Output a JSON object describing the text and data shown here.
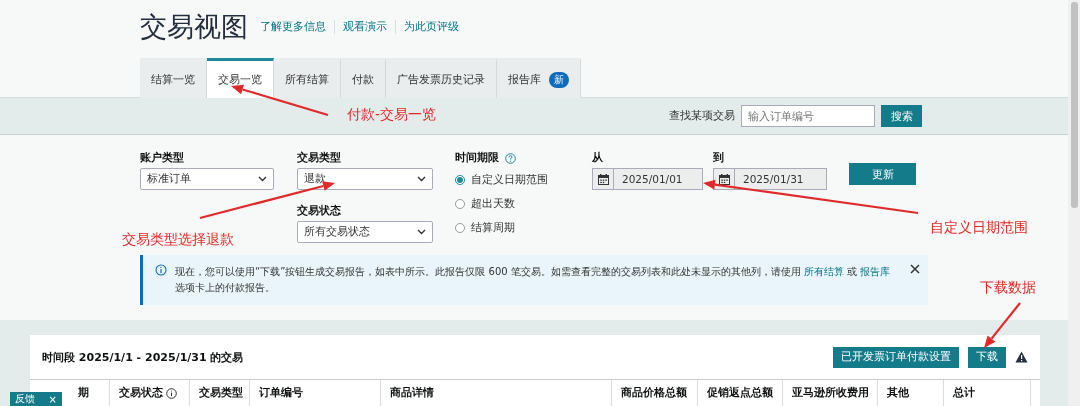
{
  "page": {
    "title": "交易视图",
    "links": [
      "了解更多信息",
      "观看演示",
      "为此页评级"
    ]
  },
  "tabs": [
    {
      "label": "结算一览",
      "selected": false
    },
    {
      "label": "交易一览",
      "selected": true
    },
    {
      "label": "所有结算",
      "selected": false
    },
    {
      "label": "付款",
      "selected": false
    },
    {
      "label": "广告发票历史记录",
      "selected": false
    },
    {
      "label": "报告库",
      "badge": "新",
      "selected": false
    }
  ],
  "search": {
    "label": "查找某项交易",
    "placeholder": "输入订单编号",
    "button": "搜索"
  },
  "filters": {
    "account_type": {
      "label": "账户类型",
      "value": "标准订单"
    },
    "transaction_type": {
      "label": "交易类型",
      "value": "退款"
    },
    "transaction_status": {
      "label": "交易状态",
      "value": "所有交易状态"
    },
    "time_period": {
      "label": "时间期限",
      "options": [
        {
          "label": "自定义日期范围",
          "selected": true
        },
        {
          "label": "超出天数",
          "selected": false
        },
        {
          "label": "结算周期",
          "selected": false
        }
      ]
    },
    "from": {
      "label": "从",
      "value": "2025/01/01"
    },
    "to": {
      "label": "到",
      "value": "2025/01/31"
    },
    "update_button": "更新"
  },
  "notice": {
    "text_before": "现在，您可以使用“下载”按钮生成交易报告，如表中所示。此报告仅限 600 笔交易。如需查看完整的交易列表和此处未显示的其他列，请使用",
    "link_1": "所有结算",
    "middle": "或",
    "link_2": "报告库",
    "text_after": "选项卡上的付款报告。"
  },
  "transactions": {
    "title": "时间段 2025/1/1 - 2025/1/31 的交易",
    "buttons": [
      "已开发票订单付款设置",
      "下载"
    ],
    "columns": [
      {
        "label": "期",
        "kind": "plain"
      },
      {
        "label": "交易状态",
        "kind": "info"
      },
      {
        "label": "交易类型",
        "kind": "plain"
      },
      {
        "label": "订单编号",
        "kind": "plain"
      },
      {
        "label": "商品详情",
        "kind": "plain"
      },
      {
        "label": "商品价格总额",
        "kind": "plain"
      },
      {
        "label": "促销返点总额",
        "kind": "plain"
      },
      {
        "label": "亚马逊所收费用",
        "kind": "plain"
      },
      {
        "label": "其他",
        "kind": "plain"
      },
      {
        "label": "总计",
        "kind": "plain"
      }
    ]
  },
  "feedback_tab": {
    "label": "反馈",
    "close": "×"
  },
  "annotations": [
    {
      "text": "付款-交易一览"
    },
    {
      "text": "交易类型选择退款"
    },
    {
      "text": "自定义日期范围"
    },
    {
      "text": "下载数据"
    }
  ]
}
